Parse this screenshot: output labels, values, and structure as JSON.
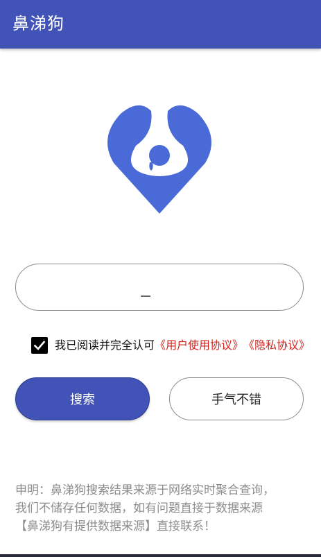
{
  "app": {
    "title": "鼻涕狗",
    "accent_color": "#4153b6",
    "logo_icon": "droplet-logo-icon"
  },
  "search": {
    "value": "",
    "placeholder": ""
  },
  "agreement": {
    "checked": true,
    "text": "我已阅读并完全认可",
    "user_agreement_link": "《用户使用协议》",
    "privacy_link": "《隐私协议》",
    "link_color": "#d0251f"
  },
  "buttons": {
    "search_label": "搜索",
    "luck_label": "手气不错"
  },
  "disclaimer": {
    "line1": "申明：鼻涕狗搜索结果来源于网络实时聚合查询，",
    "line2": "我们不储存任何数据，如有问题直接于数据来源",
    "line3": "【鼻涕狗有提供数据来源】直接联系！"
  }
}
